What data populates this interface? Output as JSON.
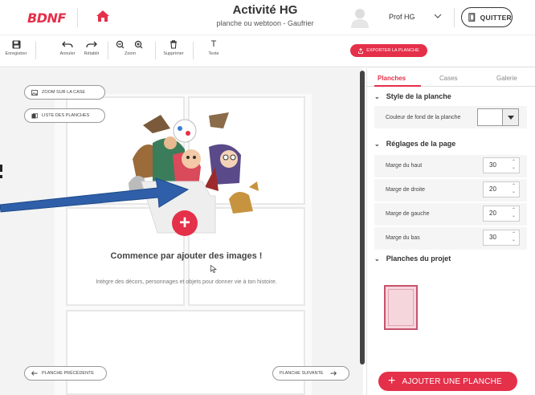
{
  "header": {
    "logo": "BDNF",
    "title": "Activité HG",
    "subtitle": "planche ou webtoon - Gaufrier",
    "user_name": "Prof HG",
    "quit_label": "QUITTER"
  },
  "toolbar": {
    "save": "Enregistrer",
    "undo": "Annuler",
    "redo": "Rétablir",
    "zoom": "Zoom",
    "delete": "Supprimer",
    "text": "Texte",
    "text_icon": "T",
    "export": "EXPORTER LA PLANCHE"
  },
  "canvas": {
    "zoom_case": "ZOOM SUR LA CASE",
    "list_pages": "LISTE DES PLANCHES",
    "empty_title": "Commence par ajouter des images !",
    "empty_sub": "Intègre des décors, personnages et objets pour donner vie à ton histoire.",
    "prev_page": "PLANCHE PRÉCÉDENTE",
    "next_page": "PLANCHE SUIVANTE",
    "add_symbol": "+"
  },
  "panel": {
    "tabs": [
      {
        "label": "Planches"
      },
      {
        "label": "Cases"
      },
      {
        "label": "Galerie"
      }
    ],
    "style_section": "Style de la planche",
    "bg_color_label": "Couleur de fond de la planche",
    "page_settings_section": "Réglages de la page",
    "margins": [
      {
        "label": "Marge du haut",
        "value": "30"
      },
      {
        "label": "Marge de droite",
        "value": "20"
      },
      {
        "label": "Marge de gauche",
        "value": "20"
      },
      {
        "label": "Marge du bas",
        "value": "30"
      }
    ],
    "project_pages_section": "Planches du projet",
    "add_page": "AJOUTER UNE PLANCHE",
    "add_page_symbol": "+"
  },
  "colors": {
    "accent": "#e5304a",
    "thumbnail_fill": "#f5d6dd",
    "arrow": "#2f5fa8"
  }
}
